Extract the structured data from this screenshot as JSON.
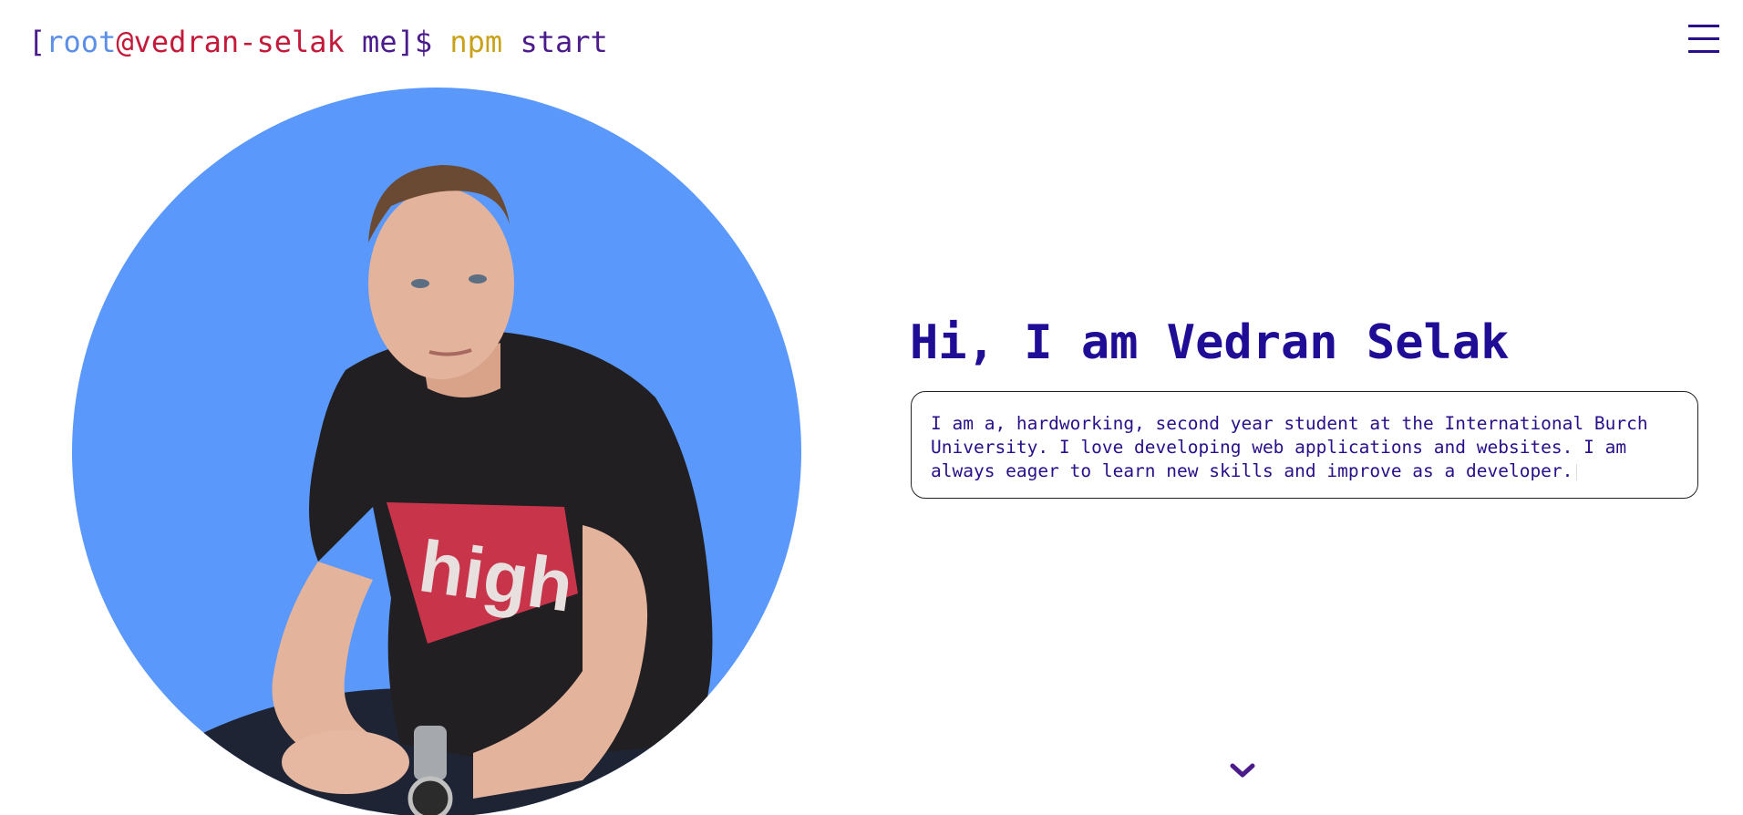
{
  "header": {
    "prompt": {
      "open_bracket": "[",
      "user": "root",
      "at": "@",
      "host": "vedran-selak",
      "dir": " me",
      "close_bracket": "]",
      "dollar": "$ ",
      "command": "npm",
      "argument": " start"
    },
    "menu_icon": "hamburger-menu-icon"
  },
  "hero": {
    "avatar_icon": "profile-photo",
    "avatar_background": "#5a99fb",
    "heading": "Hi, I am Vedran Selak",
    "bio": "I am a, hardworking, second year student at the International Burch University. I love developing web applications and websites. I am always eager to learn new skills and improve as a developer.",
    "scroll_icon": "chevron-down-icon"
  },
  "colors": {
    "accent": "#1f0d96",
    "user": "#5b8fe8",
    "host": "#c41a3a",
    "command": "#c9a21a",
    "text": "#4b1b8c"
  }
}
